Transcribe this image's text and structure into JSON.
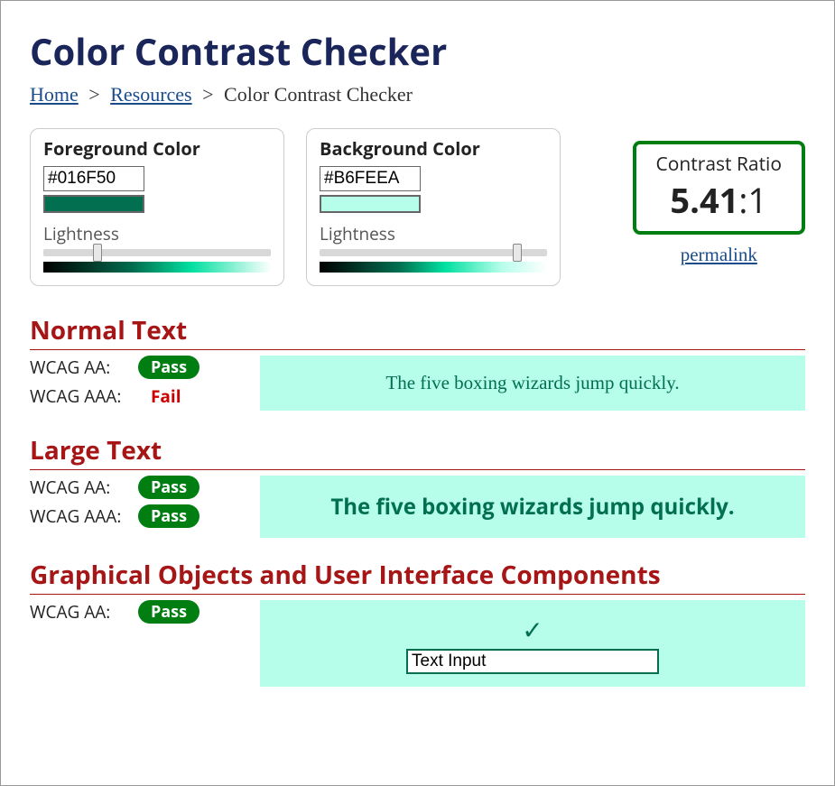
{
  "page": {
    "title": "Color Contrast Checker"
  },
  "breadcrumb": {
    "home": "Home",
    "resources": "Resources",
    "current": "Color Contrast Checker",
    "sep": ">"
  },
  "foreground": {
    "title": "Foreground Color",
    "value": "#016F50",
    "swatch_color": "#016F50",
    "lightness_label": "Lightness",
    "lightness_pct": 22
  },
  "background": {
    "title": "Background Color",
    "value": "#B6FEEA",
    "swatch_color": "#B6FEEA",
    "lightness_label": "Lightness",
    "lightness_pct": 85
  },
  "ratio": {
    "label": "Contrast Ratio",
    "value": "5.41",
    "suffix": ":1",
    "permalink": "permalink"
  },
  "sections": {
    "normal": {
      "title": "Normal Text",
      "aa_label": "WCAG AA:",
      "aa_result": "Pass",
      "aaa_label": "WCAG AAA:",
      "aaa_result": "Fail",
      "sample": "The five boxing wizards jump quickly."
    },
    "large": {
      "title": "Large Text",
      "aa_label": "WCAG AA:",
      "aa_result": "Pass",
      "aaa_label": "WCAG AAA:",
      "aaa_result": "Pass",
      "sample": "The five boxing wizards jump quickly."
    },
    "ui": {
      "title": "Graphical Objects and User Interface Components",
      "aa_label": "WCAG AA:",
      "aa_result": "Pass",
      "checkmark": "✓",
      "input_value": "Text Input"
    }
  },
  "colors": {
    "fg": "#016F50",
    "bg": "#B6FEEA",
    "pass_badge": "#007e12",
    "fail_text": "#c00",
    "section_title": "#a61617"
  }
}
